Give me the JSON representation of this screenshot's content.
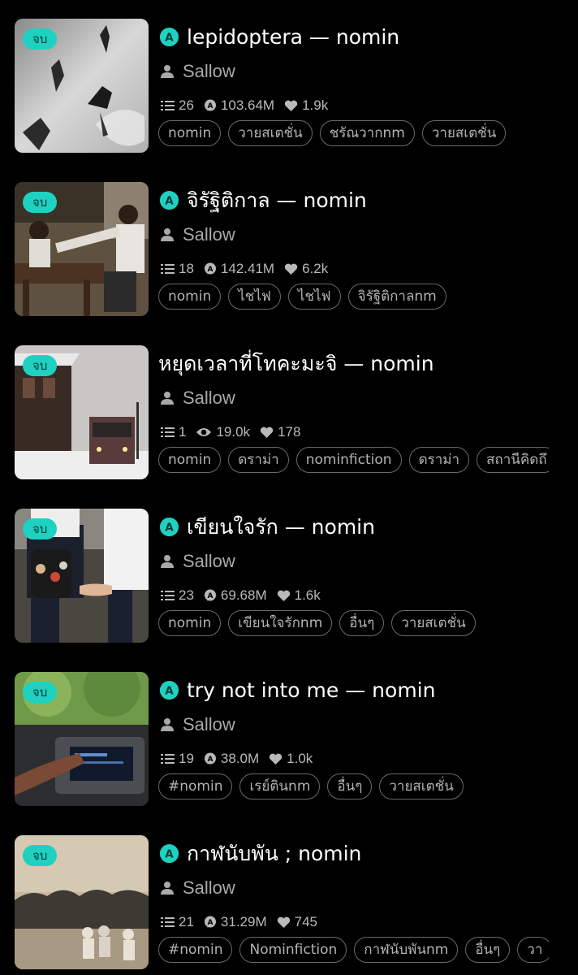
{
  "colors": {
    "background": "#000000",
    "accent": "#1fd1c0",
    "muted_text": "#a9a9a9",
    "tag_border": "#6a6a6a"
  },
  "stories": [
    {
      "badge": "จบ",
      "title": "lepidoptera — nomin",
      "has_a_icon": true,
      "author": "Sallow",
      "chapters": "26",
      "reads": "103.64M",
      "reads_icon": "comment-a-icon",
      "likes": "1.9k",
      "tags": [
        "nomin",
        "วายสเตชั่น",
        "ชรัณวากnm",
        "วายสเตชั่น"
      ],
      "cover": "butterflies-bw"
    },
    {
      "badge": "จบ",
      "title": "จิรัฐิติกาล — nomin",
      "has_a_icon": true,
      "author": "Sallow",
      "chapters": "18",
      "reads": "142.41M",
      "reads_icon": "comment-a-icon",
      "likes": "6.2k",
      "tags": [
        "nomin",
        "ไชไฟ",
        "ไชไฟ",
        "จิรัฐิติกาลnm"
      ],
      "cover": "students-desk"
    },
    {
      "badge": "จบ",
      "title": "หยุดเวลาที่โทคะมะจิ — nomin",
      "has_a_icon": false,
      "author": "Sallow",
      "chapters": "1",
      "reads": "19.0k",
      "reads_icon": "eye-icon",
      "likes": "178",
      "tags": [
        "nomin",
        "ดราม่า",
        "nominfiction",
        "ดราม่า",
        "สถานีคิดถึ"
      ],
      "cover": "snow-train"
    },
    {
      "badge": "จบ",
      "title": "เขียนใจรัก — nomin",
      "has_a_icon": true,
      "author": "Sallow",
      "chapters": "23",
      "reads": "69.68M",
      "reads_icon": "comment-a-icon",
      "likes": "1.6k",
      "tags": [
        "nomin",
        "เขียนใจรักnm",
        "อื่นๆ",
        "วายสเตชั่น"
      ],
      "cover": "holding-hands"
    },
    {
      "badge": "จบ",
      "title": "try not into me — nomin",
      "has_a_icon": true,
      "author": "Sallow",
      "chapters": "19",
      "reads": "38.0M",
      "reads_icon": "comment-a-icon",
      "likes": "1.0k",
      "tags": [
        "#nomin",
        "เรย์ตินnm",
        "อื่นๆ",
        "วายสเตชั่น"
      ],
      "cover": "car-dashboard"
    },
    {
      "badge": "จบ",
      "title": "กาฬนับพัน ; nomin",
      "has_a_icon": true,
      "author": "Sallow",
      "chapters": "21",
      "reads": "31.29M",
      "reads_icon": "comment-a-icon",
      "likes": "745",
      "tags": [
        "#nomin",
        "Nominfiction",
        "กาฬนับพันnm",
        "อื่นๆ",
        "วา"
      ],
      "cover": "field-group"
    }
  ]
}
